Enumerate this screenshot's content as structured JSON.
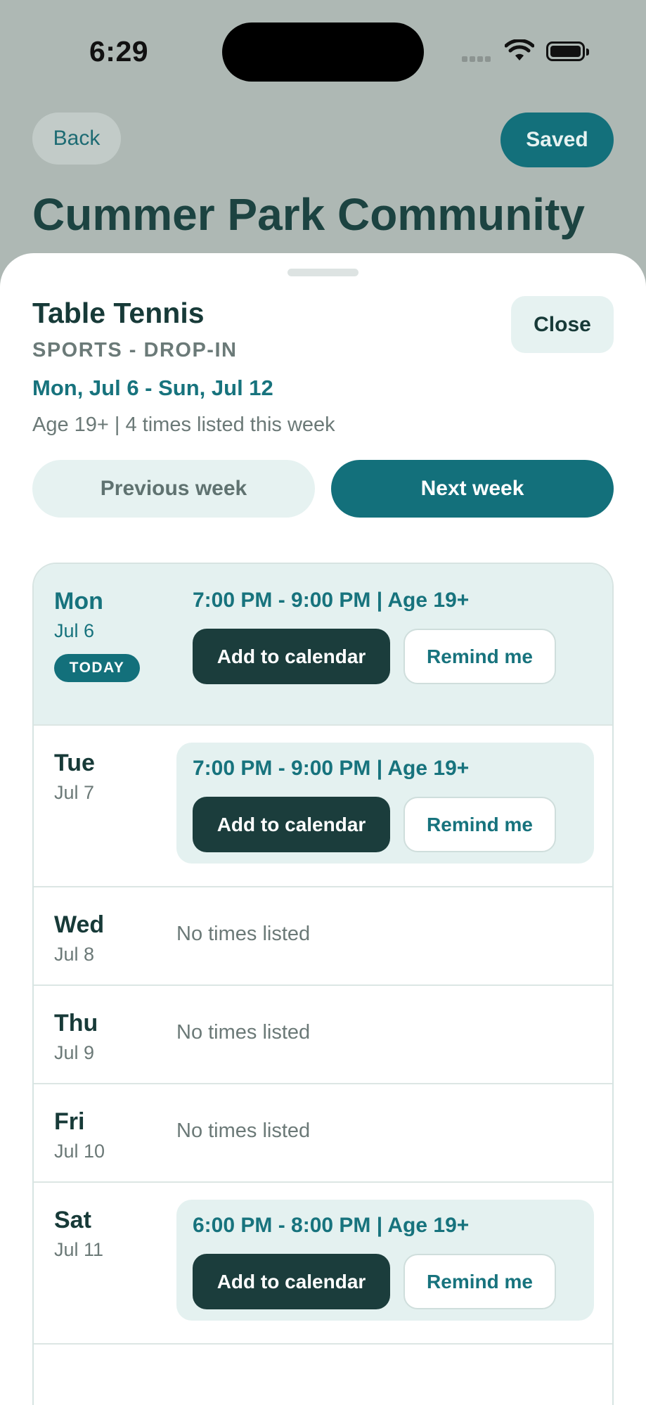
{
  "status_bar": {
    "time": "6:29"
  },
  "header": {
    "back_label": "Back",
    "saved_label": "Saved",
    "title": "Cummer Park Community"
  },
  "sheet": {
    "activity": "Table Tennis",
    "category": "SPORTS - DROP-IN",
    "date_range": "Mon, Jul 6 - Sun, Jul 12",
    "meta": "Age 19+ | 4 times listed this week",
    "close_label": "Close",
    "prev_week_label": "Previous week",
    "next_week_label": "Next week"
  },
  "schedule": {
    "today_badge": "TODAY",
    "add_calendar_label": "Add to calendar",
    "remind_label": "Remind me",
    "days": [
      {
        "name": "Mon",
        "date": "Jul 6",
        "slot": "7:00 PM - 9:00 PM | Age 19+"
      },
      {
        "name": "Tue",
        "date": "Jul 7",
        "slot": "7:00 PM - 9:00 PM | Age 19+"
      },
      {
        "name": "Wed",
        "date": "Jul 8",
        "status": "No times listed"
      },
      {
        "name": "Thu",
        "date": "Jul 9",
        "status": "No times listed"
      },
      {
        "name": "Fri",
        "date": "Jul 10",
        "status": "No times listed"
      },
      {
        "name": "Sat",
        "date": "Jul 11",
        "slot": "6:00 PM - 8:00 PM | Age 19+"
      }
    ]
  },
  "colors": {
    "accent": "#13707b",
    "dark": "#1b3d3c",
    "tint": "#e4f1f0",
    "backdrop": "#aeb8b4"
  }
}
